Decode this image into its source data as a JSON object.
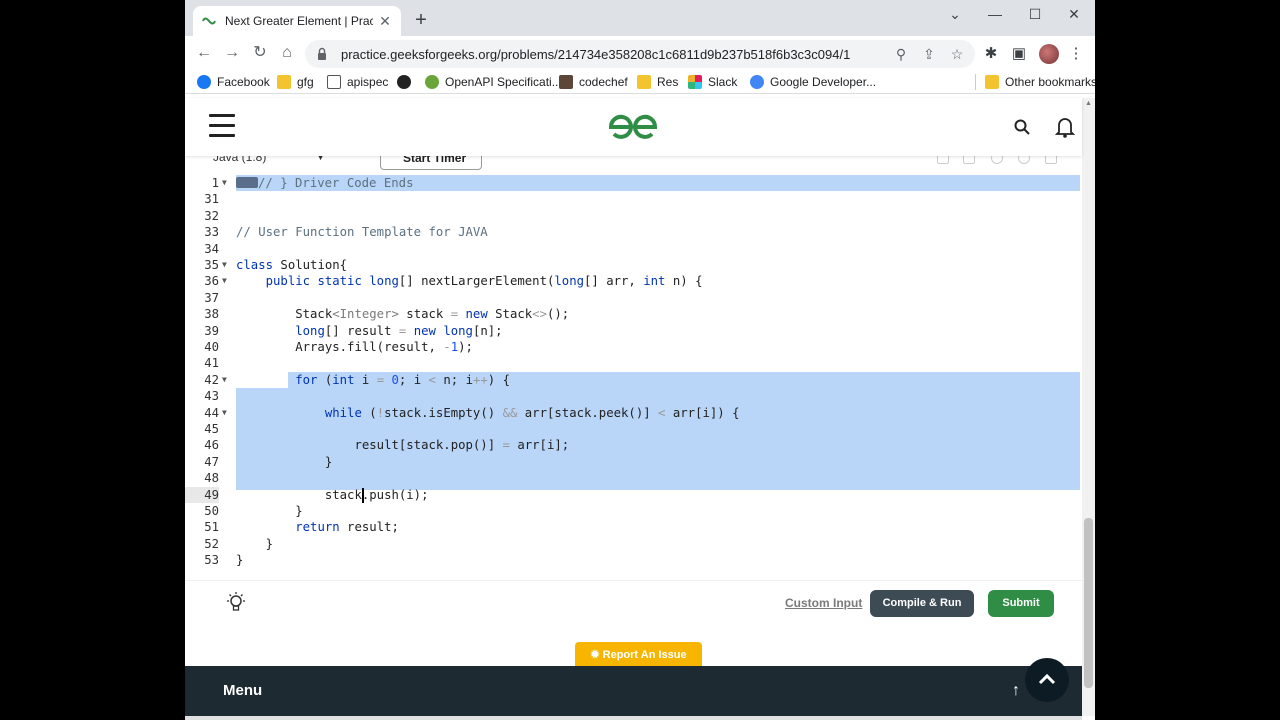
{
  "browser": {
    "tab_title": "Next Greater Element | Practice |",
    "url": "practice.geeksforgeeks.org/problems/214734e358208c1c6811d9b237b518f6b3c3c094/1"
  },
  "bookmarks": [
    {
      "label": "Facebook",
      "color": "#1877f2"
    },
    {
      "label": "gfg",
      "color": "#f4c430"
    },
    {
      "label": "apispec",
      "color": "#555555"
    },
    {
      "label": "",
      "color": "#222222"
    },
    {
      "label": "OpenAPI Specificati...",
      "color": "#6ba539"
    },
    {
      "label": "codechef",
      "color": "#5b4638"
    },
    {
      "label": "Res",
      "color": "#f4c430"
    },
    {
      "label": "Slack",
      "color": "#e01e5a"
    },
    {
      "label": "Google Developer...",
      "color": "#4285f4"
    }
  ],
  "other_bookmarks": "Other bookmarks",
  "editor": {
    "language": "Java (1.8)",
    "timer_label": "Start Timer",
    "lines": [
      {
        "num": "1",
        "html": "<span class=\"cm\">// } Driver Code Ends</span>",
        "fold": true
      },
      {
        "num": "31",
        "html": ""
      },
      {
        "num": "32",
        "html": ""
      },
      {
        "num": "33",
        "html": "<span class=\"cm\">// User Function Template for JAVA</span>"
      },
      {
        "num": "34",
        "html": ""
      },
      {
        "num": "35",
        "html": "<span class=\"kw\">class</span> Solution{",
        "fold": true
      },
      {
        "num": "36",
        "html": "    <span class=\"kw\">public static</span> <span class=\"kw\">long</span>[] nextLargerElement(<span class=\"kw\">long</span>[] arr, <span class=\"kw\">int</span> n) {",
        "fold": true
      },
      {
        "num": "37",
        "html": ""
      },
      {
        "num": "38",
        "html": "        Stack<span class=\"ty\">&lt;Integer&gt;</span> stack <span class=\"op\">=</span> <span class=\"kw\">new</span> Stack<span class=\"op\">&lt;&gt;</span>();"
      },
      {
        "num": "39",
        "html": "        <span class=\"kw\">long</span>[] result <span class=\"op\">=</span> <span class=\"kw\">new</span> <span class=\"kw\">long</span>[n];"
      },
      {
        "num": "40",
        "html": "        Arrays.fill(result, <span class=\"op\">-</span><span class=\"num\">1</span>);"
      },
      {
        "num": "41",
        "html": ""
      },
      {
        "num": "42",
        "html": "        <span class=\"kw\">for</span> (<span class=\"kw\">int</span> i <span class=\"op\">=</span> <span class=\"num\">0</span>; i <span class=\"op\">&lt;</span> n; i<span class=\"op\">++</span>) {",
        "fold": true
      },
      {
        "num": "43",
        "html": ""
      },
      {
        "num": "44",
        "html": "            <span class=\"kw\">while</span> (<span class=\"op\">!</span>stack.isEmpty() <span class=\"op\">&amp;&amp;</span> arr[stack.peek()] <span class=\"op\">&lt;</span> arr[i]) {",
        "fold": true
      },
      {
        "num": "45",
        "html": ""
      },
      {
        "num": "46",
        "html": "                result[stack.pop()] <span class=\"op\">=</span> arr[i];"
      },
      {
        "num": "47",
        "html": "            }"
      },
      {
        "num": "48",
        "html": ""
      },
      {
        "num": "49",
        "html": "            stack.push(i);"
      },
      {
        "num": "50",
        "html": "        }"
      },
      {
        "num": "51",
        "html": "        <span class=\"kw\">return</span> result;"
      },
      {
        "num": "52",
        "html": "    }"
      },
      {
        "num": "53",
        "html": "}"
      }
    ]
  },
  "actions": {
    "custom_input": "Custom Input",
    "compile_run": "Compile & Run",
    "submit": "Submit",
    "report": "Report An Issue"
  },
  "footer": {
    "menu": "Menu"
  },
  "colors": {
    "gfg_green": "#2f8d46",
    "selection": "#b9d6f8",
    "report": "#f7b500",
    "footer_bg": "#1e2a32"
  }
}
